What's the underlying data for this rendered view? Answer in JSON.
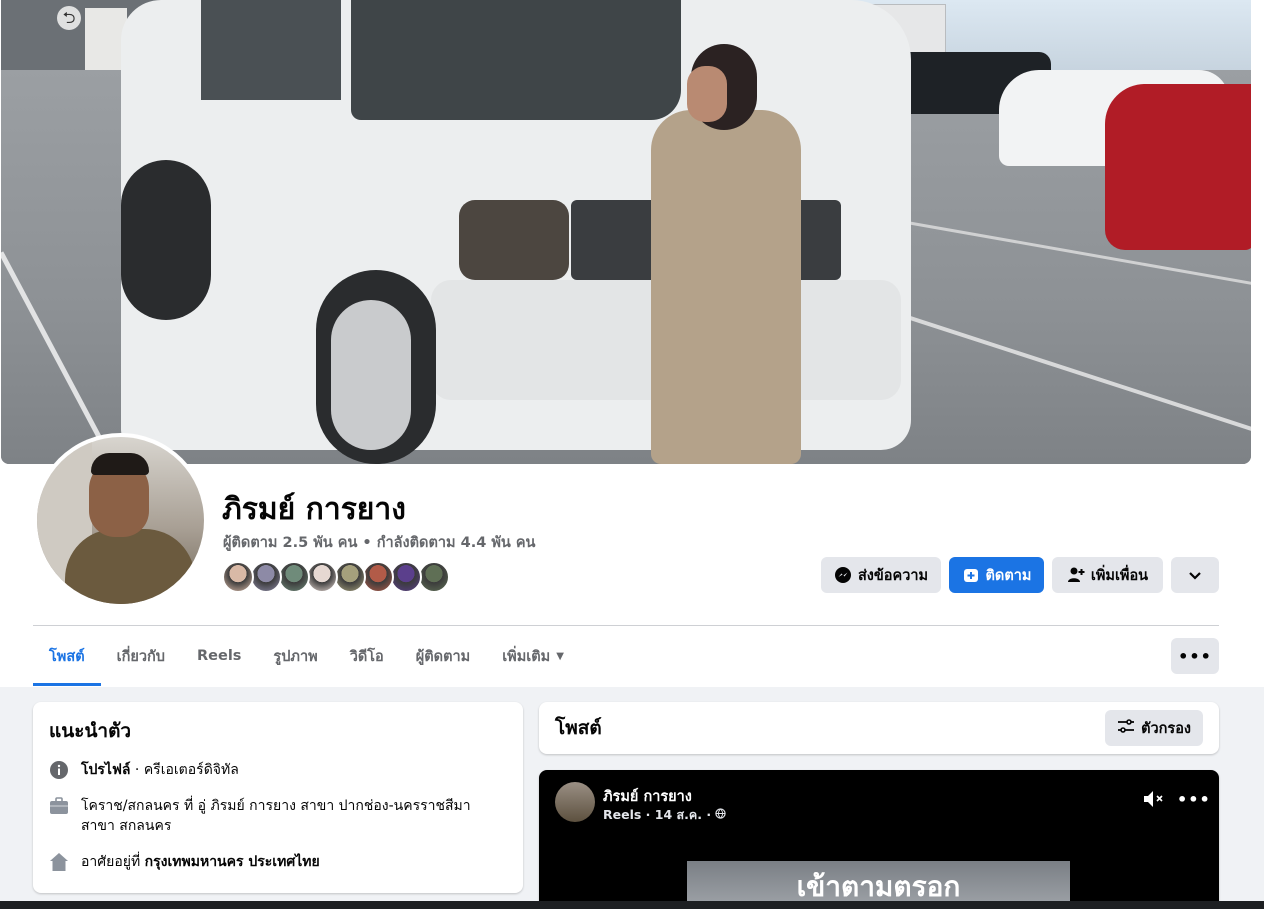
{
  "profile": {
    "name": "ภิรมย์ การยาง",
    "stats": "ผู้ติดตาม 2.5 พัน คน • กำลังติดตาม 4.4 พัน คน",
    "friend_avatar_colors": [
      "#d9b9a6",
      "#8d8aa6",
      "#6f8b7a",
      "#e6d8d2",
      "#a5a07c",
      "#b25b48",
      "#5b3f8c",
      "#5f6f55"
    ]
  },
  "actions": {
    "message": "ส่งข้อความ",
    "follow": "ติดตาม",
    "add_friend": "เพิ่มเพื่อน"
  },
  "tabs": [
    "โพสต์",
    "เกี่ยวกับ",
    "Reels",
    "รูปภาพ",
    "วิดีโอ",
    "ผู้ติดตาม",
    "เพิ่มเติม"
  ],
  "intro": {
    "title": "แนะนำตัว",
    "profile_label": "โปรไฟล์",
    "profile_value": " · ครีเอเตอร์ดิจิทัล",
    "work": "โคราช/สกลนคร ที่ อู่ ภิรมย์ การยาง สาขา ปากช่อง-นครราชสีมา สาขา สกลนคร",
    "lives_prefix": "อาศัยอยู่ที่ ",
    "lives_value": "กรุงเทพมหานคร ประเทศไทย"
  },
  "posts": {
    "title": "โพสต์",
    "filter_label": "ตัวกรอง"
  },
  "post": {
    "author": "ภิรมย์ การยาง",
    "meta": "Reels · 14 ส.ค. ·",
    "video_caption": "เข้าตามตรอก"
  },
  "colors": {
    "accent": "#1b74e4",
    "button_grey": "#e4e6eb",
    "page_bg": "#f0f2f5"
  },
  "icons": {
    "messenger": "messenger-icon",
    "follow": "follow-icon",
    "add_friend": "add-friend-icon",
    "chevron": "chevron-down-icon",
    "more": "more-icon",
    "info": "info-icon",
    "work": "briefcase-icon",
    "home": "home-icon",
    "filter": "filter-icon",
    "mute": "mute-icon",
    "globe": "globe-icon"
  }
}
